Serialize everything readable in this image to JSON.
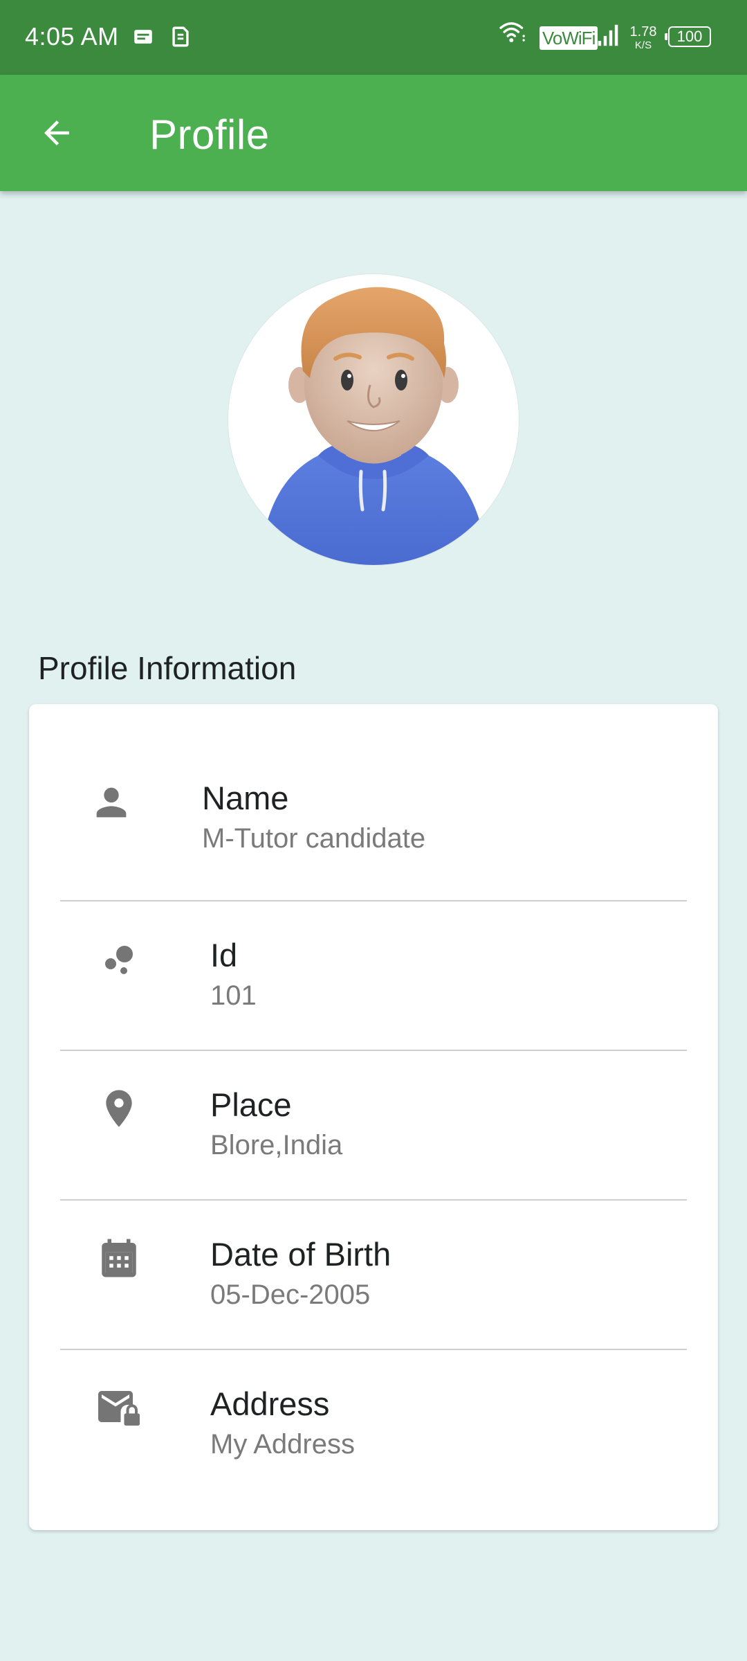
{
  "status_bar": {
    "time": "4:05 AM",
    "vowifi": "VoWiFi",
    "net_speed_value": "1.78",
    "net_speed_unit": "K/S",
    "battery": "100"
  },
  "app_bar": {
    "title": "Profile"
  },
  "section": {
    "title": "Profile Information"
  },
  "profile": [
    {
      "label": "Name",
      "value": "M-Tutor candidate",
      "icon": "person-icon"
    },
    {
      "label": "Id",
      "value": "101",
      "icon": "bubbles-icon"
    },
    {
      "label": "Place",
      "value": "Blore,India",
      "icon": "location-pin-icon"
    },
    {
      "label": "Date of Birth",
      "value": "05-Dec-2005",
      "icon": "calendar-icon"
    },
    {
      "label": "Address",
      "value": "My Address",
      "icon": "mail-lock-icon"
    }
  ],
  "colors": {
    "status_bar": "#3b8a3e",
    "app_bar": "#4caf50",
    "background": "#e0f1f0",
    "icon_gray": "#757575"
  }
}
